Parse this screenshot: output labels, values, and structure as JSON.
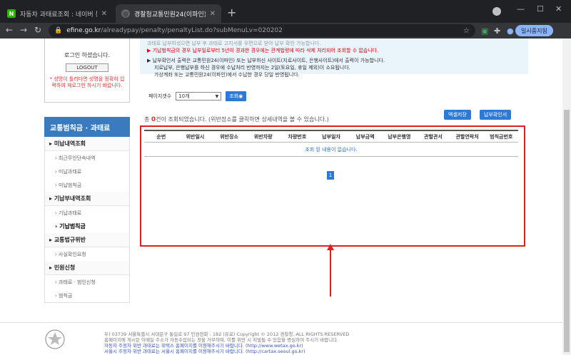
{
  "browser": {
    "tabs": [
      {
        "title": "자동차 과태료조회 : 네이버 통합",
        "active": false
      },
      {
        "title": "경찰청교통민원24(이파인)",
        "active": true
      }
    ],
    "url_host": "efine.go.kr",
    "url_path": "/alreadypay/penalty/penaltyList.do?subMenuLv=020202",
    "pause_label": "일시중지됨"
  },
  "login": {
    "status": "로그인 하셨습니다.",
    "logout_label": "LOGOUT",
    "note": "* 성명이 틀리다면 성명을 정확히 입력하여 재로그인 하시기 바랍니다."
  },
  "notice": {
    "line1": "과태료 납부하셨으면 납부 후 과태료 고지서를 우편으로 받아 납부 확인 가능합니다.",
    "line2": "기납범칙금의 경우 납부일로부터 5년이 경과한 경우에는 관계법령에 따라 삭제 처리되어 조회할 수 없습니다.",
    "line3": "납부확인서 출력은 교통민원24(이파인) 또는 납부하신 사이트(지로사이트, 은행사이트)에서 출력이 가능합니다.",
    "line4": "지로납부, 은행납부를 하신 경우에 수납처리 반영까지는 2일(토요일, 휴일 제외)이 소요됩니다.",
    "line5": "가상계좌 또는 교통민원24(이파인)에서 수납한 경우 당일 반영됩니다."
  },
  "filter": {
    "label": "페이지갯수",
    "select_value": "10개",
    "query_label": "조회"
  },
  "results": {
    "prefix": "총 ",
    "count": "0",
    "suffix": "건이 조회되었습니다. (위반장소를 클릭하면 상세내역을 볼 수 있습니다.)",
    "excel_label": "엑셀저장",
    "receipt_label": "납부확인서",
    "columns": [
      "순번",
      "위반일시",
      "위반장소",
      "위반차량",
      "차량번호",
      "납부일자",
      "납부금액",
      "납부은행명",
      "관할관서",
      "관할연락처",
      "범칙금번호"
    ],
    "empty_message": "조회 된 내용이 없습니다.",
    "page": "1"
  },
  "sidebar": {
    "header": "교통범칙금 · 과태료",
    "groups": [
      {
        "title": "미납내역조회",
        "items": [
          "최근무인단속내역",
          "미납과태료",
          "미납범칙금"
        ]
      },
      {
        "title": "기납부내역조회",
        "items": [
          "기납과태료",
          "기납범칙금"
        ]
      },
      {
        "title": "교통법규위반",
        "items": [
          "사실확인요청"
        ]
      },
      {
        "title": "민원신청",
        "items": [
          "과태료 · 범인신청",
          "범칙금"
        ]
      }
    ]
  },
  "footer": {
    "line1": "우) 03739 서울특별시 서대문구 통일로 97   민원전화 : 182 (유료)        Copyright © 2012 경찰청. ALL RIGHTS RESERVED",
    "line2": "홈페이지에 게시된 이메일 주소가 자동수집되는 것을 거부하며, 이를 위반 시 처벌될 수 있음을 명심하여 주시기 바랍니다.",
    "line3": "자동차 주정차 위반 과태료는 위택스 홈페이지를 이용해주시기 바랍니다. (http://www.wetax.go.kr)",
    "line4": "서울시 주정차 위반 과태료는 서울시 홈페이지를 이용해주시기 바랍니다. (http://cartax.seoul.go.kr)"
  },
  "colors": {
    "accent_blue": "#2d7ad6",
    "highlight_red": "#e02020",
    "sidebar_header": "#3a7bbf"
  }
}
